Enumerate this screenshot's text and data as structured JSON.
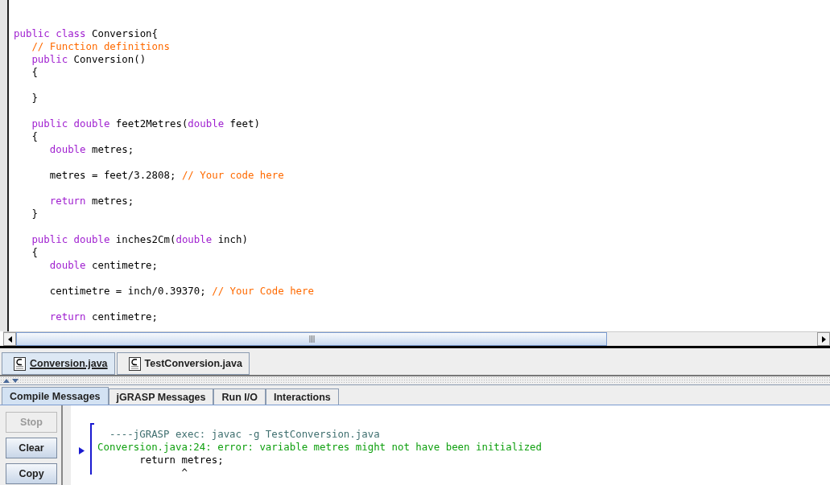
{
  "editor": {
    "lines": [
      {
        "kind": "code",
        "segments": [
          {
            "text": "public class ",
            "kind": "keyword"
          },
          {
            "text": "Conversion{",
            "kind": "plain"
          }
        ]
      },
      {
        "kind": "code",
        "segments": [
          {
            "text": "   // Function definitions",
            "kind": "comment"
          }
        ]
      },
      {
        "kind": "code",
        "segments": [
          {
            "text": "   public ",
            "kind": "keyword"
          },
          {
            "text": "Conversion()",
            "kind": "plain"
          }
        ]
      },
      {
        "kind": "code",
        "segments": [
          {
            "text": "   {",
            "kind": "plain"
          }
        ]
      },
      {
        "kind": "blank"
      },
      {
        "kind": "code",
        "segments": [
          {
            "text": "   }",
            "kind": "plain"
          }
        ]
      },
      {
        "kind": "blank"
      },
      {
        "kind": "code",
        "segments": [
          {
            "text": "   public double ",
            "kind": "keyword"
          },
          {
            "text": "feet2Metres(",
            "kind": "plain"
          },
          {
            "text": "double ",
            "kind": "keyword"
          },
          {
            "text": "feet)",
            "kind": "plain"
          }
        ]
      },
      {
        "kind": "code",
        "segments": [
          {
            "text": "   {",
            "kind": "plain"
          }
        ]
      },
      {
        "kind": "code",
        "segments": [
          {
            "text": "      double ",
            "kind": "keyword"
          },
          {
            "text": "metres;",
            "kind": "plain"
          }
        ]
      },
      {
        "kind": "blank"
      },
      {
        "kind": "code",
        "segments": [
          {
            "text": "      metres = feet/3.2808; ",
            "kind": "plain"
          },
          {
            "text": "// Your code here",
            "kind": "comment"
          }
        ]
      },
      {
        "kind": "blank"
      },
      {
        "kind": "code",
        "segments": [
          {
            "text": "      return ",
            "kind": "keyword"
          },
          {
            "text": "metres;",
            "kind": "plain"
          }
        ]
      },
      {
        "kind": "code",
        "segments": [
          {
            "text": "   }",
            "kind": "plain"
          }
        ]
      },
      {
        "kind": "blank"
      },
      {
        "kind": "code",
        "segments": [
          {
            "text": "   public double ",
            "kind": "keyword"
          },
          {
            "text": "inches2Cm(",
            "kind": "plain"
          },
          {
            "text": "double ",
            "kind": "keyword"
          },
          {
            "text": "inch)",
            "kind": "plain"
          }
        ]
      },
      {
        "kind": "code",
        "segments": [
          {
            "text": "   {",
            "kind": "plain"
          }
        ]
      },
      {
        "kind": "code",
        "segments": [
          {
            "text": "      double ",
            "kind": "keyword"
          },
          {
            "text": "centimetre;",
            "kind": "plain"
          }
        ]
      },
      {
        "kind": "blank"
      },
      {
        "kind": "code",
        "segments": [
          {
            "text": "      centimetre = inch/0.39370; ",
            "kind": "plain"
          },
          {
            "text": "// Your Code here",
            "kind": "comment"
          }
        ]
      },
      {
        "kind": "blank"
      },
      {
        "kind": "code",
        "segments": [
          {
            "text": "      return ",
            "kind": "keyword"
          },
          {
            "text": "centimetre;",
            "kind": "plain"
          }
        ]
      }
    ]
  },
  "file_tabs": [
    {
      "label": "Conversion.java",
      "selected": true
    },
    {
      "label": "TestConversion.java",
      "selected": false
    }
  ],
  "message_tabs": [
    {
      "label": "Compile Messages",
      "selected": true
    },
    {
      "label": "jGRASP Messages",
      "selected": false
    },
    {
      "label": "Run I/O",
      "selected": false
    },
    {
      "label": "Interactions",
      "selected": false
    }
  ],
  "buttons": [
    {
      "label": "Stop",
      "disabled": true
    },
    {
      "label": "Clear",
      "disabled": false
    },
    {
      "label": "Copy",
      "disabled": false
    }
  ],
  "messages": [
    {
      "text": "  ----jGRASP exec: javac -g TestConversion.java",
      "kind": "header"
    },
    {
      "text": "Conversion.java:24: error: variable metres might not have been initialized",
      "kind": "error"
    },
    {
      "text": "       return metres;",
      "kind": "source"
    },
    {
      "text": "              ^",
      "kind": "source"
    }
  ]
}
